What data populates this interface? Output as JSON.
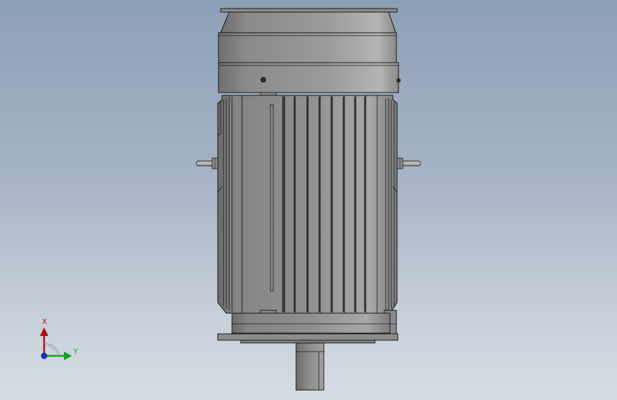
{
  "viewport": {
    "background_top": "#8d9fb7",
    "background_bottom": "#d6dce3"
  },
  "model": {
    "subject": "electric motor"
  },
  "triad": {
    "x_label": "X",
    "y_label": "Y",
    "x_color": "#b01010",
    "y_color": "#10a020",
    "z_color": "#1030c0"
  }
}
